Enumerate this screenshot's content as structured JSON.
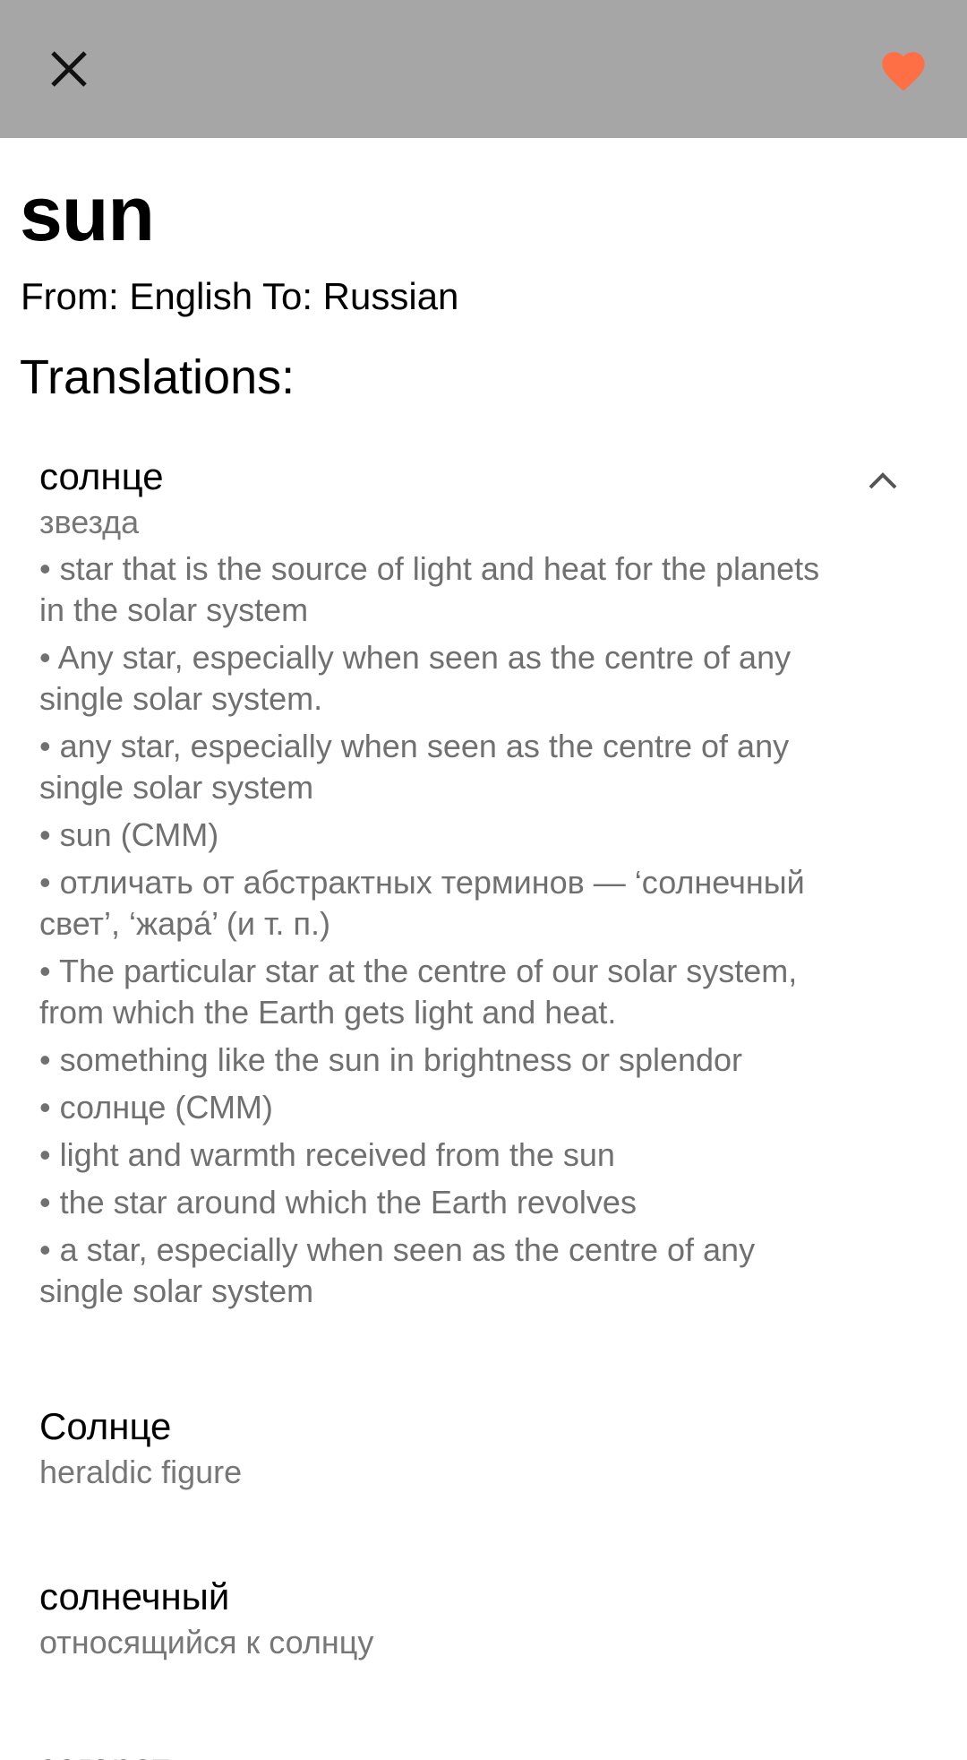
{
  "toolbar": {
    "close_icon": "close-icon",
    "favorite_icon": "heart-icon",
    "favorite_color": "#ff6f45",
    "background": "#a6a6a6"
  },
  "header": {
    "word": "sun",
    "from_to": "From: English To: Russian",
    "translations_heading": "Translations:"
  },
  "translations": [
    {
      "word": "солнце",
      "subtitle": "звезда",
      "expanded": true,
      "definitions": [
        "• star that is the source of light and heat for the planets in the solar system",
        "• Any star, especially when seen as the centre of any single solar system.",
        "• any star, especially when seen as the centre of any single solar system",
        "• sun (СММ)",
        "• отличать от абстрактных терминов — ‘солнечный свет’, ‘жара́’ (и т. п.)",
        "• The particular star at the centre of our solar system, from which the Earth gets light and heat.",
        "• something like the sun in brightness or splendor",
        "• солнце (СММ)",
        "• light and warmth received from the sun",
        "• the star around which the Earth revolves",
        "• a star, especially when seen as the centre of any single solar system"
      ]
    },
    {
      "word": "Солнце",
      "subtitle": "heraldic figure"
    },
    {
      "word": "солнечный",
      "subtitle": "относящийся к солнцу"
    },
    {
      "word": "загорать"
    }
  ]
}
